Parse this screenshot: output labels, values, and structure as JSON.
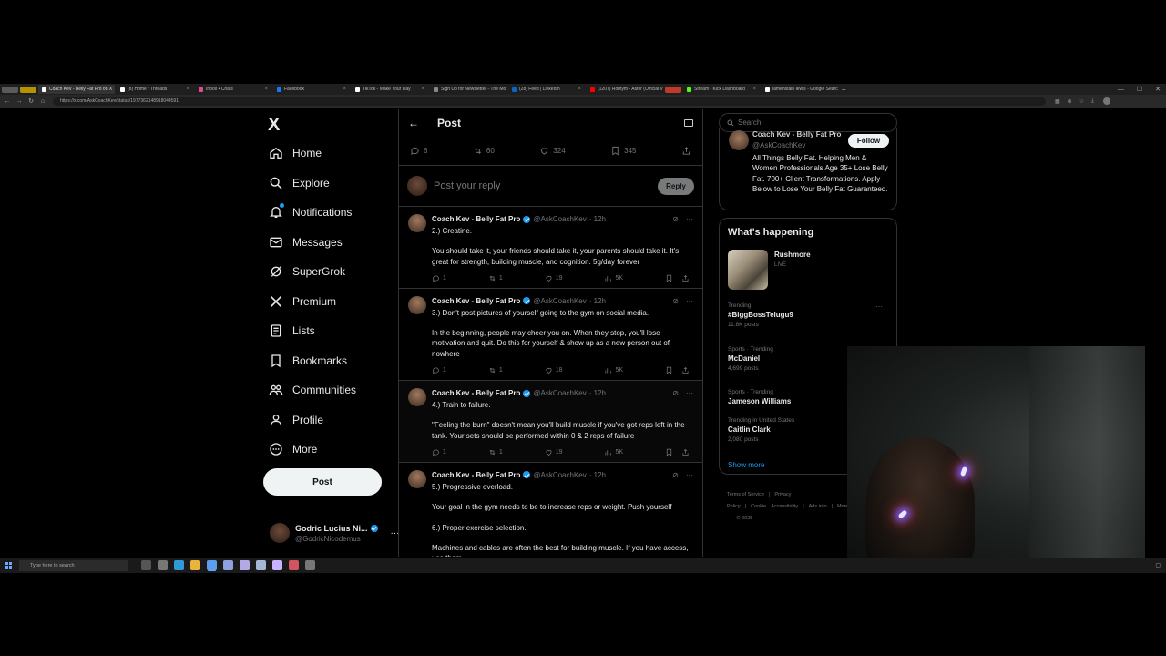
{
  "browser": {
    "tabs": [
      {
        "label": "",
        "color": "#888888",
        "chip": true,
        "chip_bg": "#5a5a5a"
      },
      {
        "label": "",
        "color": "#c8a000",
        "chip": true,
        "chip_bg": "#b59300"
      },
      {
        "label": "Coach Kev - Belly Fat Pro on X",
        "color": "#ffffff",
        "active": true
      },
      {
        "label": "(8) Home / Threads",
        "color": "#ffffff"
      },
      {
        "label": "Inbox • Chats",
        "color": "#e24a8d"
      },
      {
        "label": "Facebook",
        "color": "#1877f2"
      },
      {
        "label": "TikTok - Make Your Day",
        "color": "#ffffff"
      },
      {
        "label": "Sign Up for Newsletter - The Mo",
        "color": "#888888"
      },
      {
        "label": "(28) Feed | LinkedIn",
        "color": "#0a66c2"
      },
      {
        "label": "(1207) Romym - Aster (Official V",
        "color": "#ff0000"
      },
      {
        "label": "",
        "color": "#ff3b30",
        "chip": true,
        "chip_bg": "#c0392b"
      },
      {
        "label": "Stream - Kick Dashboard",
        "color": "#53fc18"
      },
      {
        "label": "lamenstain lewis - Google Search",
        "color": "#ffffff"
      }
    ],
    "new_tab": "+",
    "url": "https://x.com/AskCoachKev/status/1977362148918044591"
  },
  "sidebar": {
    "logo": "X",
    "items": [
      {
        "label": "Home",
        "icon": "home-icon"
      },
      {
        "label": "Explore",
        "icon": "search-icon"
      },
      {
        "label": "Notifications",
        "icon": "bell-icon"
      },
      {
        "label": "Messages",
        "icon": "mail-icon"
      },
      {
        "label": "SuperGrok",
        "icon": "grok-icon"
      },
      {
        "label": "Premium",
        "icon": "x-premium-icon"
      },
      {
        "label": "Lists",
        "icon": "list-icon"
      },
      {
        "label": "Bookmarks",
        "icon": "bookmark-icon"
      },
      {
        "label": "Communities",
        "icon": "communities-icon"
      },
      {
        "label": "Profile",
        "icon": "person-icon"
      },
      {
        "label": "More",
        "icon": "more-circle-icon"
      }
    ],
    "post_label": "Post",
    "account": {
      "name": "Godric Lucius Ni...",
      "handle": "@GodricNicodemus"
    }
  },
  "main": {
    "header_title": "Post",
    "stats": {
      "replies": "6",
      "reposts": "60",
      "likes": "324",
      "bookmarks": "345"
    },
    "reply_placeholder": "Post your reply",
    "reply_button": "Reply",
    "tweets": [
      {
        "name": "Coach Kev - Belly Fat Pro",
        "handle": "@AskCoachKev",
        "time": "· 12h",
        "paragraphs": [
          "2.) Creatine.",
          "You should take it, your friends should take it, your parents should take it. It's great for strength, building muscle, and cognition. 5g/day forever"
        ],
        "replies": "1",
        "reposts": "1",
        "likes": "19",
        "views": "5K"
      },
      {
        "name": "Coach Kev - Belly Fat Pro",
        "handle": "@AskCoachKev",
        "time": "· 12h",
        "paragraphs": [
          "3.) Don't post pictures of yourself going to the gym on social media.",
          "In the beginning, people may cheer you on. When they stop, you'll lose motivation and quit. Do this for yourself & show up as a new person out of nowhere"
        ],
        "replies": "1",
        "reposts": "1",
        "likes": "18",
        "views": "5K"
      },
      {
        "name": "Coach Kev - Belly Fat Pro",
        "handle": "@AskCoachKev",
        "time": "· 12h",
        "paragraphs": [
          "4.) Train to failure.",
          "\"Feeling the burn\" doesn't mean you'll build muscle if you've got reps left in the tank. Your sets should be performed within 0 & 2 reps of failure"
        ],
        "replies": "1",
        "reposts": "1",
        "likes": "19",
        "views": "5K"
      },
      {
        "name": "Coach Kev - Belly Fat Pro",
        "handle": "@AskCoachKev",
        "time": "· 12h",
        "paragraphs": [
          "5.) Progressive overload.",
          "Your goal in the gym needs to be to increase reps or weight. Push yourself",
          "6.) Proper exercise selection.",
          "Machines and cables are often the best for building muscle. If you have access, use them"
        ],
        "replies": "",
        "reposts": "",
        "likes": "",
        "views": ""
      }
    ]
  },
  "right": {
    "search_placeholder": "Search",
    "profile_card": {
      "name": "Coach Kev - Belly Fat Pro",
      "handle": "@AskCoachKev",
      "follow": "Follow",
      "bio": "All Things Belly Fat. Helping Men & Women Professionals Age 35+ Lose Belly Fat. 700+ Client Transformations. Apply Below to Lose Your Belly Fat Guaranteed."
    },
    "whats_happening": {
      "title": "What's happening",
      "live": {
        "name": "Rushmore",
        "tag": "LIVE"
      },
      "trends": [
        {
          "context": "Trending",
          "name": "#BiggBossTelugu9",
          "count": "11.8K posts",
          "more": "···"
        },
        {
          "context": "Sports · Trending",
          "name": "McDaniel",
          "count": "4,699 posts",
          "more": ""
        },
        {
          "context": "Sports · Trending",
          "name": "Jameson Williams",
          "count": "",
          "more": ""
        },
        {
          "context": "Trending in United States",
          "name": "Caitlin Clark",
          "count": "2,080 posts",
          "more": ""
        }
      ],
      "show_more": "Show more"
    },
    "footer_links": [
      "Terms of Service",
      "|",
      "Privacy Policy",
      "|",
      "Cookie",
      "Accessibility",
      "|",
      "Ads info",
      "|",
      "More ···",
      "© 2025"
    ]
  },
  "taskbar": {
    "search_placeholder": "Type here to search",
    "apps": [
      {
        "name": "task-view-app",
        "color": "#555555"
      },
      {
        "name": "store-app",
        "color": "#777777"
      },
      {
        "name": "edge-app",
        "color": "#2f9bd6"
      },
      {
        "name": "explorer-app",
        "color": "#e9b43b"
      },
      {
        "name": "chrome-app",
        "color": "#5c9ded",
        "active": true
      },
      {
        "name": "discord-app",
        "color": "#8ea1e1"
      },
      {
        "name": "app-7",
        "color": "#b5a8e6"
      },
      {
        "name": "steam-app",
        "color": "#a6b7d6"
      },
      {
        "name": "obs-app",
        "color": "#c9b3ff"
      },
      {
        "name": "app-10",
        "color": "#d05560"
      },
      {
        "name": "app-11",
        "color": "#777777"
      }
    ]
  }
}
